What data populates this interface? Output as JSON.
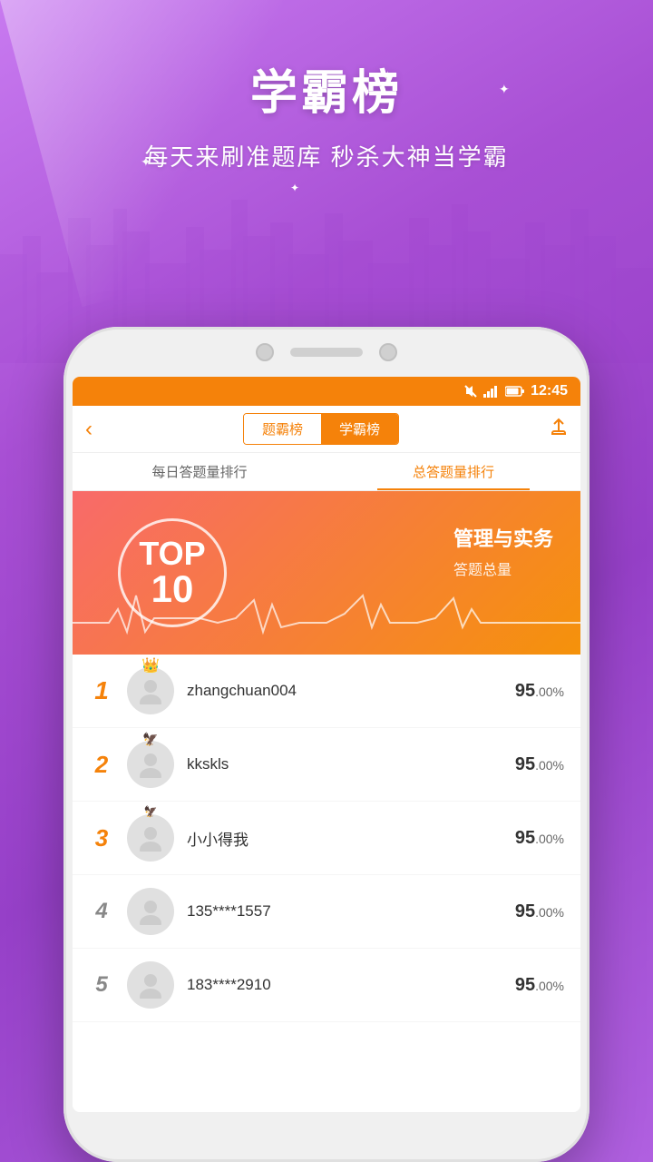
{
  "background": {
    "gradient_start": "#c87af0",
    "gradient_end": "#9640c8"
  },
  "header": {
    "title": "学霸榜",
    "subtitle": "每天来刷准题库 秒杀大神当学霸",
    "sparkle_symbol": "✦"
  },
  "status_bar": {
    "time": "12:45",
    "signal_icon": "signal",
    "battery_icon": "battery",
    "mute_icon": "mute"
  },
  "nav": {
    "back_icon": "‹",
    "tab1_label": "题霸榜",
    "tab2_label": "学霸榜",
    "share_icon": "share",
    "active_tab": "学霸榜"
  },
  "sub_tabs": {
    "tab1_label": "每日答题量排行",
    "tab2_label": "总答题量排行",
    "active": "总答题量排行"
  },
  "banner": {
    "top_label": "TOP",
    "num_label": "10",
    "subject": "管理与实务",
    "answer_label": "答题总量"
  },
  "leaderboard": [
    {
      "rank": "1",
      "username": "zhangchuan004",
      "score": "95",
      "score_decimal": ".00",
      "score_unit": "%",
      "has_crown": true
    },
    {
      "rank": "2",
      "username": "kkskls",
      "score": "95",
      "score_decimal": ".00",
      "score_unit": "%",
      "has_crown": false,
      "has_wings": true
    },
    {
      "rank": "3",
      "username": "小小得我",
      "score": "95",
      "score_decimal": ".00",
      "score_unit": "%",
      "has_crown": false,
      "has_wings": true
    },
    {
      "rank": "4",
      "username": "135****1557",
      "score": "95",
      "score_decimal": ".00",
      "score_unit": "%",
      "has_crown": false
    },
    {
      "rank": "5",
      "username": "183****2910",
      "score": "95",
      "score_decimal": ".00",
      "score_unit": "%",
      "has_crown": false
    }
  ]
}
